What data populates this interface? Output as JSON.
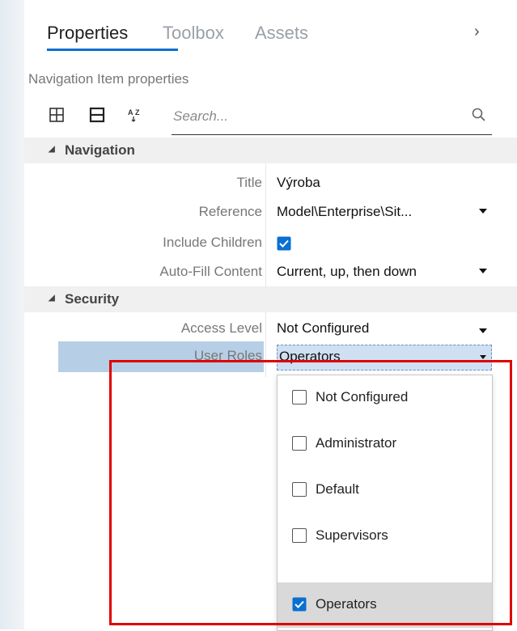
{
  "tabs": [
    {
      "label": "Properties",
      "active": true
    },
    {
      "label": "Toolbox",
      "active": false
    },
    {
      "label": "Assets",
      "active": false
    }
  ],
  "subtitle": "Navigation Item properties",
  "toolbar": {
    "expand_icon": "expand-all-icon",
    "collapse_icon": "collapse-all-icon",
    "sort_icon": "sort-alphabetical-icon"
  },
  "search": {
    "placeholder": "Search...",
    "value": "",
    "icon": "search-icon"
  },
  "categories": {
    "navigation": "Navigation",
    "security": "Security"
  },
  "properties": {
    "title": {
      "name": "Title",
      "value": "Výroba"
    },
    "reference": {
      "name": "Reference",
      "value": "Model\\Enterprise\\Sit..."
    },
    "include_children": {
      "name": "Include Children",
      "checked": true
    },
    "auto_fill": {
      "name": "Auto-Fill Content",
      "value": "Current, up, then down"
    },
    "access_level": {
      "name": "Access Level",
      "value": "Not Configured"
    },
    "user_roles": {
      "name": "User Roles",
      "value": "Operators"
    }
  },
  "user_roles_options": [
    {
      "label": "Not Configured",
      "checked": false
    },
    {
      "label": "Administrator",
      "checked": false
    },
    {
      "label": "Default",
      "checked": false
    },
    {
      "label": "Supervisors",
      "checked": false
    },
    {
      "label": "Operators",
      "checked": true
    }
  ],
  "colors": {
    "accent": "#0a6fd1",
    "selected_row": "#b7cfe6",
    "highlight_box": "#e00000"
  }
}
